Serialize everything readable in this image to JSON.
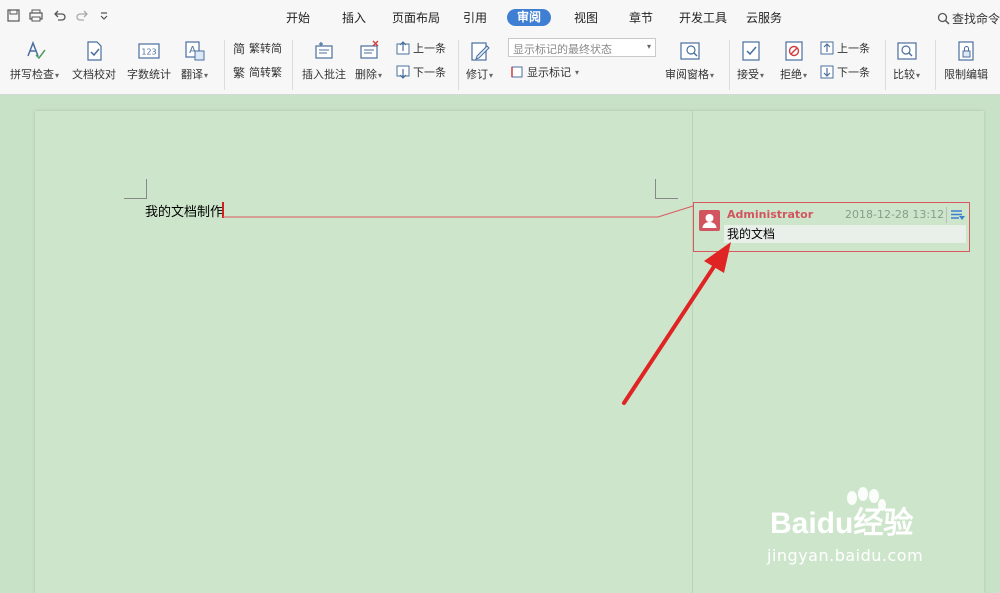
{
  "menu_tabs": [
    "开始",
    "插入",
    "页面布局",
    "引用",
    "审阅",
    "视图",
    "章节",
    "开发工具",
    "云服务"
  ],
  "active_tab": "审阅",
  "search_label": "查找命令...",
  "ribbon": {
    "spell_check": "拼写检查",
    "doc_proofread": "文档校对",
    "word_count": "字数统计",
    "translate": "翻译",
    "trad_to_simp": "繁转简",
    "simp_to_trad": "简转繁",
    "insert_comment": "插入批注",
    "delete": "删除",
    "prev_comment": "上一条",
    "next_comment": "下一条",
    "track_changes": "修订",
    "markup_state": "显示标记的最终状态",
    "show_markup": "显示标记",
    "review_pane": "审阅窗格",
    "accept": "接受",
    "reject": "拒绝",
    "prev_change": "上一条",
    "next_change": "下一条",
    "compare": "比较",
    "restrict_editing": "限制编辑"
  },
  "document": {
    "text": "我的文档制作"
  },
  "comment": {
    "author": "Administrator",
    "date": "2018-12-28 13:12",
    "body": "我的文档"
  },
  "watermark": {
    "brand": "Baidu经验",
    "url": "jingyan.baidu.com"
  },
  "colors": {
    "accent": "#3f7fd3",
    "comment_border": "#d9585f",
    "arrow": "#e02424",
    "page": "#cde6cb"
  }
}
